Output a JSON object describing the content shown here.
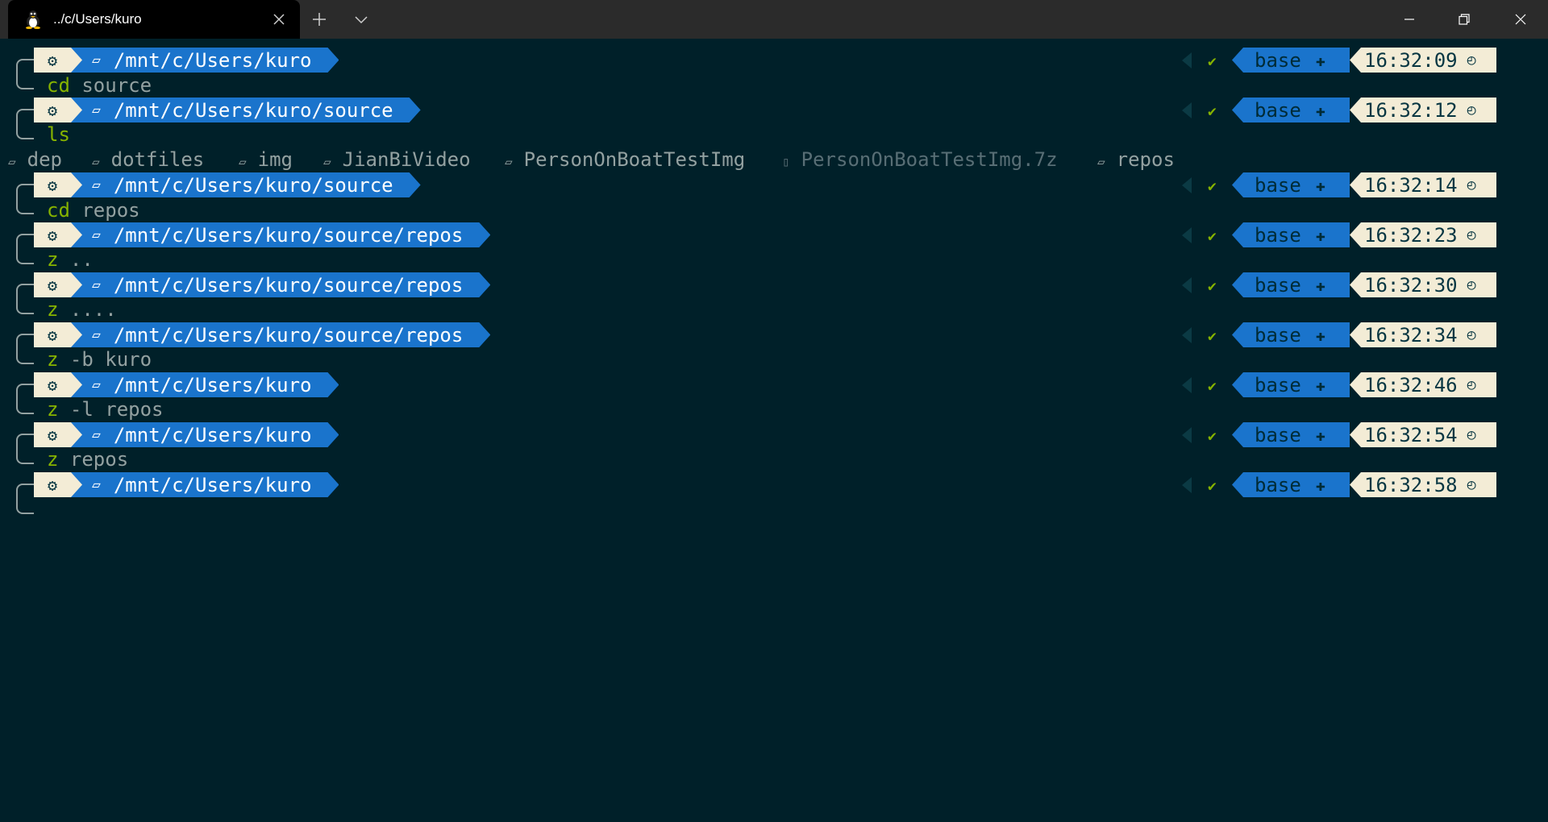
{
  "window": {
    "tab_title": "../c/Users/kuro",
    "tab_icon": "linux-penguin-icon"
  },
  "colors": {
    "background": "#002029",
    "path_segment": "#1a74cc",
    "light_segment": "#f3ecd6",
    "command_name": "#86b300",
    "text": "#93a1a1"
  },
  "prompts": [
    {
      "path": "/mnt/c/Users/kuro",
      "env": "base",
      "time": "16:32:09",
      "command": "cd",
      "args": " source"
    },
    {
      "path": "/mnt/c/Users/kuro/source",
      "env": "base",
      "time": "16:32:12",
      "command": "ls",
      "args": ""
    },
    {
      "path": "/mnt/c/Users/kuro/source",
      "env": "base",
      "time": "16:32:14",
      "command": "cd",
      "args": " repos"
    },
    {
      "path": "/mnt/c/Users/kuro/source/repos",
      "env": "base",
      "time": "16:32:23",
      "command": "z",
      "args": " .."
    },
    {
      "path": "/mnt/c/Users/kuro/source/repos",
      "env": "base",
      "time": "16:32:30",
      "command": "z",
      "args": " ...."
    },
    {
      "path": "/mnt/c/Users/kuro/source/repos",
      "env": "base",
      "time": "16:32:34",
      "command": "z",
      "args": " -b kuro"
    },
    {
      "path": "/mnt/c/Users/kuro",
      "env": "base",
      "time": "16:32:46",
      "command": "z",
      "args": " -l repos"
    },
    {
      "path": "/mnt/c/Users/kuro",
      "env": "base",
      "time": "16:32:54",
      "command": "z",
      "args": " repos"
    },
    {
      "path": "/mnt/c/Users/kuro",
      "env": "base",
      "time": "16:32:58",
      "command": "",
      "args": ""
    }
  ],
  "ls_output": [
    {
      "name": "dep",
      "kind": "folder"
    },
    {
      "name": "dotfiles",
      "kind": "folder"
    },
    {
      "name": "img",
      "kind": "folder"
    },
    {
      "name": "JianBiVideo",
      "kind": "folder"
    },
    {
      "name": "PersonOnBoatTestImg",
      "kind": "folder"
    },
    {
      "name": "PersonOnBoatTestImg.7z",
      "kind": "file"
    },
    {
      "name": "repos",
      "kind": "folder"
    }
  ]
}
